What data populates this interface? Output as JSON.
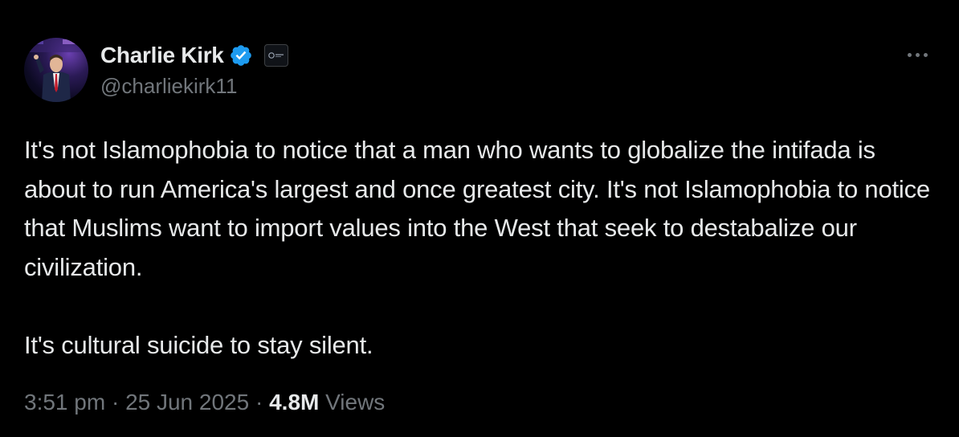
{
  "author": {
    "display_name": "Charlie Kirk",
    "handle": "@charliekirk11",
    "verified": true,
    "verified_color": "#1d9bf0",
    "affiliate_icon": "organization-logo-icon"
  },
  "tweet": {
    "paragraphs": [
      "It's not Islamophobia to notice that a man who wants to globalize the intifada is about to run America's largest and once greatest city. It's not Islamophobia to notice that Muslims want to import values into the West that seek to destabalize our civilization.",
      "It's cultural suicide to stay silent."
    ]
  },
  "meta": {
    "time": "3:51 pm",
    "date": "25 Jun 2025",
    "separator": "·",
    "views_count": "4.8M",
    "views_label": "Views"
  },
  "colors": {
    "background": "#000000",
    "text_primary": "#e7e9ea",
    "text_secondary": "#71767b",
    "accent": "#1d9bf0"
  },
  "icons": {
    "more": "more-options-icon",
    "verified": "verified-badge-icon"
  }
}
